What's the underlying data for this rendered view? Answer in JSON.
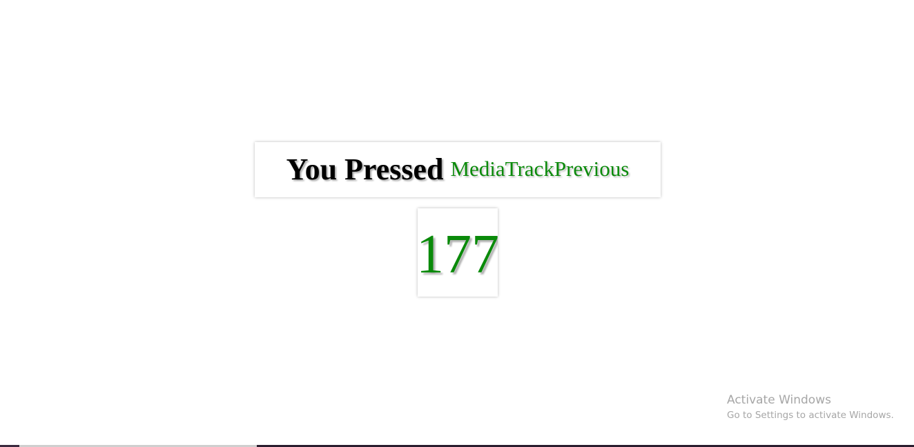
{
  "key_display": {
    "heading": "You Pressed",
    "key_name": "MediaTrackPrevious",
    "key_code": "177"
  },
  "watermark": {
    "title": "Activate Windows",
    "subtitle": "Go to Settings to activate Windows."
  },
  "colors": {
    "accent_green": "#0a8a0a",
    "heading_black": "#000000",
    "watermark_gray": "#a6a6a6"
  }
}
